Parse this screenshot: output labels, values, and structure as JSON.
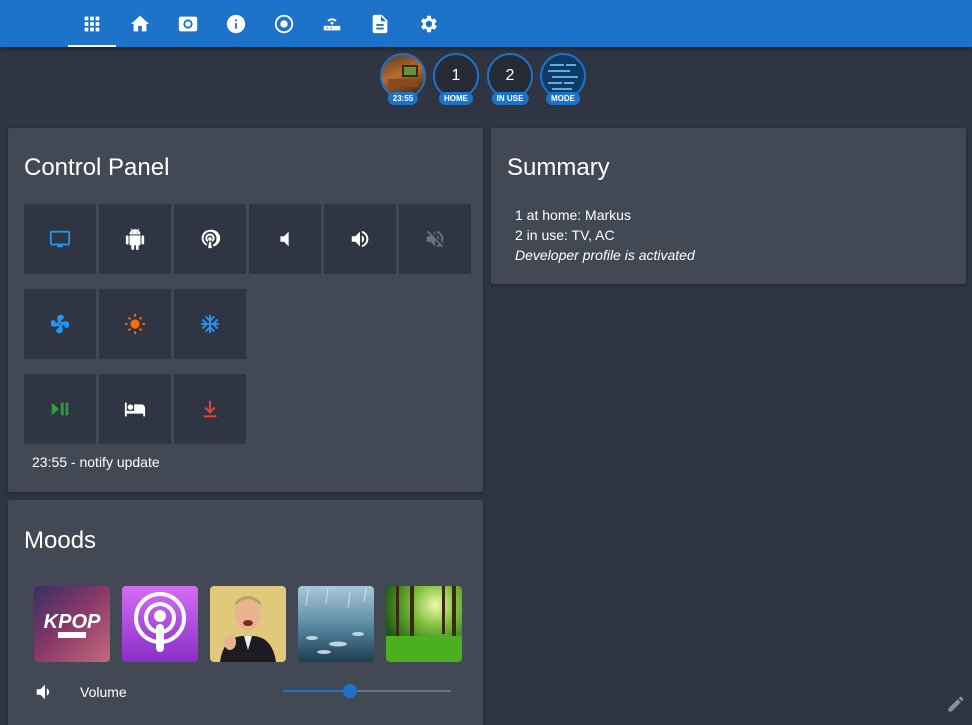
{
  "nav": {
    "tabs": [
      {
        "icon": "apps-grid-icon",
        "active": true
      },
      {
        "icon": "home-icon"
      },
      {
        "icon": "surround-speaker-icon"
      },
      {
        "icon": "info-icon"
      },
      {
        "icon": "target-record-icon"
      },
      {
        "icon": "router-icon"
      },
      {
        "icon": "document-icon"
      },
      {
        "icon": "settings-gear-icon"
      }
    ]
  },
  "badges": [
    {
      "value": "",
      "label": "23:55"
    },
    {
      "value": "1",
      "label": "HOME"
    },
    {
      "value": "2",
      "label": "IN USE"
    },
    {
      "value": "",
      "label": "MODE"
    }
  ],
  "control_panel": {
    "title": "Control Panel",
    "rows": [
      [
        {
          "icon": "monitor-icon",
          "color": "#2196f3"
        },
        {
          "icon": "android-icon",
          "color": "#ffffff"
        },
        {
          "icon": "podcast-icon",
          "color": "#ffffff"
        },
        {
          "icon": "volume-low-icon",
          "color": "#ffffff"
        },
        {
          "icon": "volume-high-icon",
          "color": "#ffffff"
        },
        {
          "icon": "volume-off-icon",
          "color": "#6b7280"
        }
      ],
      [
        {
          "icon": "fan-icon",
          "color": "#2196f3"
        },
        {
          "icon": "sun-icon",
          "color": "#ff6d00"
        },
        {
          "icon": "snowflake-icon",
          "color": "#2196f3"
        }
      ],
      [
        {
          "icon": "play-pause-icon",
          "color": "#2e9d3a"
        },
        {
          "icon": "bed-icon",
          "color": "#ffffff"
        },
        {
          "icon": "download-icon",
          "color": "#f44336"
        }
      ]
    ],
    "notify": "23:55 - notify update"
  },
  "summary": {
    "title": "Summary",
    "lines": [
      "1 at home: Markus",
      "2 in use: TV, AC"
    ],
    "italic_line": "Developer profile is activated"
  },
  "moods": {
    "title": "Moods",
    "items": [
      {
        "name": "kpop",
        "text": "KPOP"
      },
      {
        "name": "podcast"
      },
      {
        "name": "person"
      },
      {
        "name": "rain"
      },
      {
        "name": "forest"
      }
    ],
    "volume_label": "Volume",
    "volume_level": 0.4
  }
}
